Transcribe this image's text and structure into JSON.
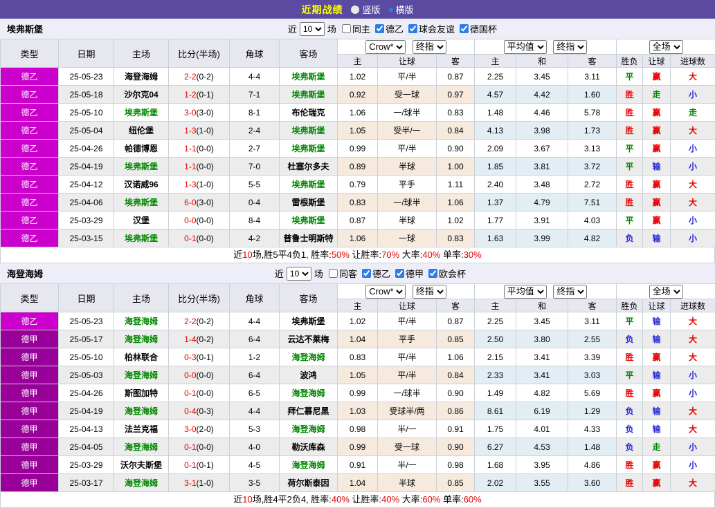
{
  "topbar": {
    "title": "近期战绩",
    "vertical_label": "竖版",
    "horizontal_label": "横版"
  },
  "colors": {
    "topbar_bg": "#5a4aa0",
    "title_yellow": "#ffff00",
    "league_de2": "#cc00cc",
    "league_de1": "#990099",
    "highlight_green": "#008800",
    "score_red": "#e60000",
    "result_blue": "#2626d8"
  },
  "table_headers": {
    "left": [
      "类型",
      "日期",
      "主场",
      "比分(半场)",
      "角球",
      "客场"
    ],
    "right": [
      "主",
      "让球",
      "客",
      "主",
      "和",
      "客",
      "胜负",
      "让球",
      "进球数"
    ]
  },
  "sections": [
    {
      "team": "埃弗斯堡",
      "near_label": "近",
      "count": "10",
      "games_label": "场",
      "checkboxes": [
        {
          "label": "同主",
          "checked": false
        },
        {
          "label": "德乙",
          "checked": true
        },
        {
          "label": "球会友谊",
          "checked": true
        },
        {
          "label": "德国杯",
          "checked": true
        }
      ],
      "selects": {
        "company": "Crow*",
        "stage": "终指",
        "average": "平均值",
        "stage2": "终指",
        "scope": "全场"
      },
      "rows": [
        {
          "league": "德乙",
          "league_color": "#cc00cc",
          "date": "25-05-23",
          "home": "海登海姆",
          "home_highlight": false,
          "score": "2-2",
          "half": "(0-2)",
          "corners": "4-4",
          "away": "埃弗斯堡",
          "away_highlight": true,
          "odds": [
            "1.02",
            "平/半",
            "0.87"
          ],
          "avg": [
            "2.25",
            "3.45",
            "3.11"
          ],
          "results": [
            {
              "text": "平",
              "color": "green"
            },
            {
              "text": "赢",
              "color": "red"
            },
            {
              "text": "大",
              "color": "red"
            }
          ]
        },
        {
          "league": "德乙",
          "league_color": "#cc00cc",
          "date": "25-05-18",
          "home": "沙尔克04",
          "home_highlight": false,
          "score": "1-2",
          "half": "(0-1)",
          "corners": "7-1",
          "away": "埃弗斯堡",
          "away_highlight": true,
          "odds": [
            "0.92",
            "受一球",
            "0.97"
          ],
          "avg": [
            "4.57",
            "4.42",
            "1.60"
          ],
          "results": [
            {
              "text": "胜",
              "color": "red"
            },
            {
              "text": "走",
              "color": "green"
            },
            {
              "text": "小",
              "color": "blue"
            }
          ]
        },
        {
          "league": "德乙",
          "league_color": "#cc00cc",
          "date": "25-05-10",
          "home": "埃弗斯堡",
          "home_highlight": true,
          "score": "3-0",
          "half": "(3-0)",
          "corners": "8-1",
          "away": "布伦瑞克",
          "away_highlight": false,
          "odds": [
            "1.06",
            "一/球半",
            "0.83"
          ],
          "avg": [
            "1.48",
            "4.46",
            "5.78"
          ],
          "results": [
            {
              "text": "胜",
              "color": "red"
            },
            {
              "text": "赢",
              "color": "red"
            },
            {
              "text": "走",
              "color": "green"
            }
          ]
        },
        {
          "league": "德乙",
          "league_color": "#cc00cc",
          "date": "25-05-04",
          "home": "纽伦堡",
          "home_highlight": false,
          "score": "1-3",
          "half": "(1-0)",
          "corners": "2-4",
          "away": "埃弗斯堡",
          "away_highlight": true,
          "odds": [
            "1.05",
            "受半/一",
            "0.84"
          ],
          "avg": [
            "4.13",
            "3.98",
            "1.73"
          ],
          "results": [
            {
              "text": "胜",
              "color": "red"
            },
            {
              "text": "赢",
              "color": "red"
            },
            {
              "text": "大",
              "color": "red"
            }
          ]
        },
        {
          "league": "德乙",
          "league_color": "#cc00cc",
          "date": "25-04-26",
          "home": "帕德博恩",
          "home_highlight": false,
          "score": "1-1",
          "half": "(0-0)",
          "corners": "2-7",
          "away": "埃弗斯堡",
          "away_highlight": true,
          "odds": [
            "0.99",
            "平/半",
            "0.90"
          ],
          "avg": [
            "2.09",
            "3.67",
            "3.13"
          ],
          "results": [
            {
              "text": "平",
              "color": "green"
            },
            {
              "text": "赢",
              "color": "red"
            },
            {
              "text": "小",
              "color": "blue"
            }
          ]
        },
        {
          "league": "德乙",
          "league_color": "#cc00cc",
          "date": "25-04-19",
          "home": "埃弗斯堡",
          "home_highlight": true,
          "score": "1-1",
          "half": "(0-0)",
          "corners": "7-0",
          "away": "杜塞尔多夫",
          "away_highlight": false,
          "odds": [
            "0.89",
            "半球",
            "1.00"
          ],
          "avg": [
            "1.85",
            "3.81",
            "3.72"
          ],
          "results": [
            {
              "text": "平",
              "color": "green"
            },
            {
              "text": "输",
              "color": "blue"
            },
            {
              "text": "小",
              "color": "blue"
            }
          ]
        },
        {
          "league": "德乙",
          "league_color": "#cc00cc",
          "date": "25-04-12",
          "home": "汉诺威96",
          "home_highlight": false,
          "score": "1-3",
          "half": "(1-0)",
          "corners": "5-5",
          "away": "埃弗斯堡",
          "away_highlight": true,
          "odds": [
            "0.79",
            "平手",
            "1.11"
          ],
          "avg": [
            "2.40",
            "3.48",
            "2.72"
          ],
          "results": [
            {
              "text": "胜",
              "color": "red"
            },
            {
              "text": "赢",
              "color": "red"
            },
            {
              "text": "大",
              "color": "red"
            }
          ]
        },
        {
          "league": "德乙",
          "league_color": "#cc00cc",
          "date": "25-04-06",
          "home": "埃弗斯堡",
          "home_highlight": true,
          "score": "6-0",
          "half": "(3-0)",
          "corners": "0-4",
          "away": "雷根斯堡",
          "away_highlight": false,
          "odds": [
            "0.83",
            "一/球半",
            "1.06"
          ],
          "avg": [
            "1.37",
            "4.79",
            "7.51"
          ],
          "results": [
            {
              "text": "胜",
              "color": "red"
            },
            {
              "text": "赢",
              "color": "red"
            },
            {
              "text": "大",
              "color": "red"
            }
          ]
        },
        {
          "league": "德乙",
          "league_color": "#cc00cc",
          "date": "25-03-29",
          "home": "汉堡",
          "home_highlight": false,
          "score": "0-0",
          "half": "(0-0)",
          "corners": "8-4",
          "away": "埃弗斯堡",
          "away_highlight": true,
          "odds": [
            "0.87",
            "半球",
            "1.02"
          ],
          "avg": [
            "1.77",
            "3.91",
            "4.03"
          ],
          "results": [
            {
              "text": "平",
              "color": "green"
            },
            {
              "text": "赢",
              "color": "red"
            },
            {
              "text": "小",
              "color": "blue"
            }
          ]
        },
        {
          "league": "德乙",
          "league_color": "#cc00cc",
          "date": "25-03-15",
          "home": "埃弗斯堡",
          "home_highlight": true,
          "score": "0-1",
          "half": "(0-0)",
          "corners": "4-2",
          "away": "普鲁士明斯特",
          "away_highlight": false,
          "odds": [
            "1.06",
            "一球",
            "0.83"
          ],
          "avg": [
            "1.63",
            "3.99",
            "4.82"
          ],
          "results": [
            {
              "text": "负",
              "color": "blue"
            },
            {
              "text": "输",
              "color": "blue"
            },
            {
              "text": "小",
              "color": "blue"
            }
          ]
        }
      ],
      "summary": [
        {
          "text": "近",
          "color": "black"
        },
        {
          "text": "10",
          "color": "red"
        },
        {
          "text": "场,胜5平4负1, 胜率:",
          "color": "black"
        },
        {
          "text": "50%",
          "color": "red"
        },
        {
          "text": " 让胜率:",
          "color": "black"
        },
        {
          "text": "70%",
          "color": "red"
        },
        {
          "text": " 大率:",
          "color": "black"
        },
        {
          "text": "40%",
          "color": "red"
        },
        {
          "text": " 单率:",
          "color": "black"
        },
        {
          "text": "30%",
          "color": "red"
        }
      ]
    },
    {
      "team": "海登海姆",
      "near_label": "近",
      "count": "10",
      "games_label": "场",
      "checkboxes": [
        {
          "label": "同客",
          "checked": false
        },
        {
          "label": "德乙",
          "checked": true
        },
        {
          "label": "德甲",
          "checked": true
        },
        {
          "label": "欧会杯",
          "checked": true
        }
      ],
      "selects": {
        "company": "Crow*",
        "stage": "终指",
        "average": "平均值",
        "stage2": "终指",
        "scope": "全场"
      },
      "rows": [
        {
          "league": "德乙",
          "league_color": "#cc00cc",
          "date": "25-05-23",
          "home": "海登海姆",
          "home_highlight": true,
          "score": "2-2",
          "half": "(0-2)",
          "corners": "4-4",
          "away": "埃弗斯堡",
          "away_highlight": false,
          "odds": [
            "1.02",
            "平/半",
            "0.87"
          ],
          "avg": [
            "2.25",
            "3.45",
            "3.11"
          ],
          "results": [
            {
              "text": "平",
              "color": "green"
            },
            {
              "text": "输",
              "color": "blue"
            },
            {
              "text": "大",
              "color": "red"
            }
          ]
        },
        {
          "league": "德甲",
          "league_color": "#990099",
          "date": "25-05-17",
          "home": "海登海姆",
          "home_highlight": true,
          "score": "1-4",
          "half": "(0-2)",
          "corners": "6-4",
          "away": "云达不莱梅",
          "away_highlight": false,
          "odds": [
            "1.04",
            "平手",
            "0.85"
          ],
          "avg": [
            "2.50",
            "3.80",
            "2.55"
          ],
          "results": [
            {
              "text": "负",
              "color": "blue"
            },
            {
              "text": "输",
              "color": "blue"
            },
            {
              "text": "大",
              "color": "red"
            }
          ]
        },
        {
          "league": "德甲",
          "league_color": "#990099",
          "date": "25-05-10",
          "home": "柏林联合",
          "home_highlight": false,
          "score": "0-3",
          "half": "(0-1)",
          "corners": "1-2",
          "away": "海登海姆",
          "away_highlight": true,
          "odds": [
            "0.83",
            "平/半",
            "1.06"
          ],
          "avg": [
            "2.15",
            "3.41",
            "3.39"
          ],
          "results": [
            {
              "text": "胜",
              "color": "red"
            },
            {
              "text": "赢",
              "color": "red"
            },
            {
              "text": "大",
              "color": "red"
            }
          ]
        },
        {
          "league": "德甲",
          "league_color": "#990099",
          "date": "25-05-03",
          "home": "海登海姆",
          "home_highlight": true,
          "score": "0-0",
          "half": "(0-0)",
          "corners": "6-4",
          "away": "波鸿",
          "away_highlight": false,
          "odds": [
            "1.05",
            "平/半",
            "0.84"
          ],
          "avg": [
            "2.33",
            "3.41",
            "3.03"
          ],
          "results": [
            {
              "text": "平",
              "color": "green"
            },
            {
              "text": "输",
              "color": "blue"
            },
            {
              "text": "小",
              "color": "blue"
            }
          ]
        },
        {
          "league": "德甲",
          "league_color": "#990099",
          "date": "25-04-26",
          "home": "斯图加特",
          "home_highlight": false,
          "score": "0-1",
          "half": "(0-0)",
          "corners": "6-5",
          "away": "海登海姆",
          "away_highlight": true,
          "odds": [
            "0.99",
            "一/球半",
            "0.90"
          ],
          "avg": [
            "1.49",
            "4.82",
            "5.69"
          ],
          "results": [
            {
              "text": "胜",
              "color": "red"
            },
            {
              "text": "赢",
              "color": "red"
            },
            {
              "text": "小",
              "color": "blue"
            }
          ]
        },
        {
          "league": "德甲",
          "league_color": "#990099",
          "date": "25-04-19",
          "home": "海登海姆",
          "home_highlight": true,
          "score": "0-4",
          "half": "(0-3)",
          "corners": "4-4",
          "away": "拜仁慕尼黑",
          "away_highlight": false,
          "odds": [
            "1.03",
            "受球半/两",
            "0.86"
          ],
          "avg": [
            "8.61",
            "6.19",
            "1.29"
          ],
          "results": [
            {
              "text": "负",
              "color": "blue"
            },
            {
              "text": "输",
              "color": "blue"
            },
            {
              "text": "大",
              "color": "red"
            }
          ]
        },
        {
          "league": "德甲",
          "league_color": "#990099",
          "date": "25-04-13",
          "home": "法兰克福",
          "home_highlight": false,
          "score": "3-0",
          "half": "(2-0)",
          "corners": "5-3",
          "away": "海登海姆",
          "away_highlight": true,
          "odds": [
            "0.98",
            "半/一",
            "0.91"
          ],
          "avg": [
            "1.75",
            "4.01",
            "4.33"
          ],
          "results": [
            {
              "text": "负",
              "color": "blue"
            },
            {
              "text": "输",
              "color": "blue"
            },
            {
              "text": "大",
              "color": "red"
            }
          ]
        },
        {
          "league": "德甲",
          "league_color": "#990099",
          "date": "25-04-05",
          "home": "海登海姆",
          "home_highlight": true,
          "score": "0-1",
          "half": "(0-0)",
          "corners": "4-0",
          "away": "勒沃库森",
          "away_highlight": false,
          "odds": [
            "0.99",
            "受一球",
            "0.90"
          ],
          "avg": [
            "6.27",
            "4.53",
            "1.48"
          ],
          "results": [
            {
              "text": "负",
              "color": "blue"
            },
            {
              "text": "走",
              "color": "green"
            },
            {
              "text": "小",
              "color": "blue"
            }
          ]
        },
        {
          "league": "德甲",
          "league_color": "#990099",
          "date": "25-03-29",
          "home": "沃尔夫斯堡",
          "home_highlight": false,
          "score": "0-1",
          "half": "(0-1)",
          "corners": "4-5",
          "away": "海登海姆",
          "away_highlight": true,
          "odds": [
            "0.91",
            "半/一",
            "0.98"
          ],
          "avg": [
            "1.68",
            "3.95",
            "4.86"
          ],
          "results": [
            {
              "text": "胜",
              "color": "red"
            },
            {
              "text": "赢",
              "color": "red"
            },
            {
              "text": "小",
              "color": "blue"
            }
          ]
        },
        {
          "league": "德甲",
          "league_color": "#990099",
          "date": "25-03-17",
          "home": "海登海姆",
          "home_highlight": true,
          "score": "3-1",
          "half": "(1-0)",
          "corners": "3-5",
          "away": "荷尔斯泰因",
          "away_highlight": false,
          "odds": [
            "1.04",
            "半球",
            "0.85"
          ],
          "avg": [
            "2.02",
            "3.55",
            "3.60"
          ],
          "results": [
            {
              "text": "胜",
              "color": "red"
            },
            {
              "text": "赢",
              "color": "red"
            },
            {
              "text": "大",
              "color": "red"
            }
          ]
        }
      ],
      "summary": [
        {
          "text": "近",
          "color": "black"
        },
        {
          "text": "10",
          "color": "red"
        },
        {
          "text": "场,胜4平2负4, 胜率:",
          "color": "black"
        },
        {
          "text": "40%",
          "color": "red"
        },
        {
          "text": " 让胜率:",
          "color": "black"
        },
        {
          "text": "40%",
          "color": "red"
        },
        {
          "text": " 大率:",
          "color": "black"
        },
        {
          "text": "60%",
          "color": "red"
        },
        {
          "text": " 单率:",
          "color": "black"
        },
        {
          "text": "60%",
          "color": "red"
        }
      ]
    }
  ]
}
